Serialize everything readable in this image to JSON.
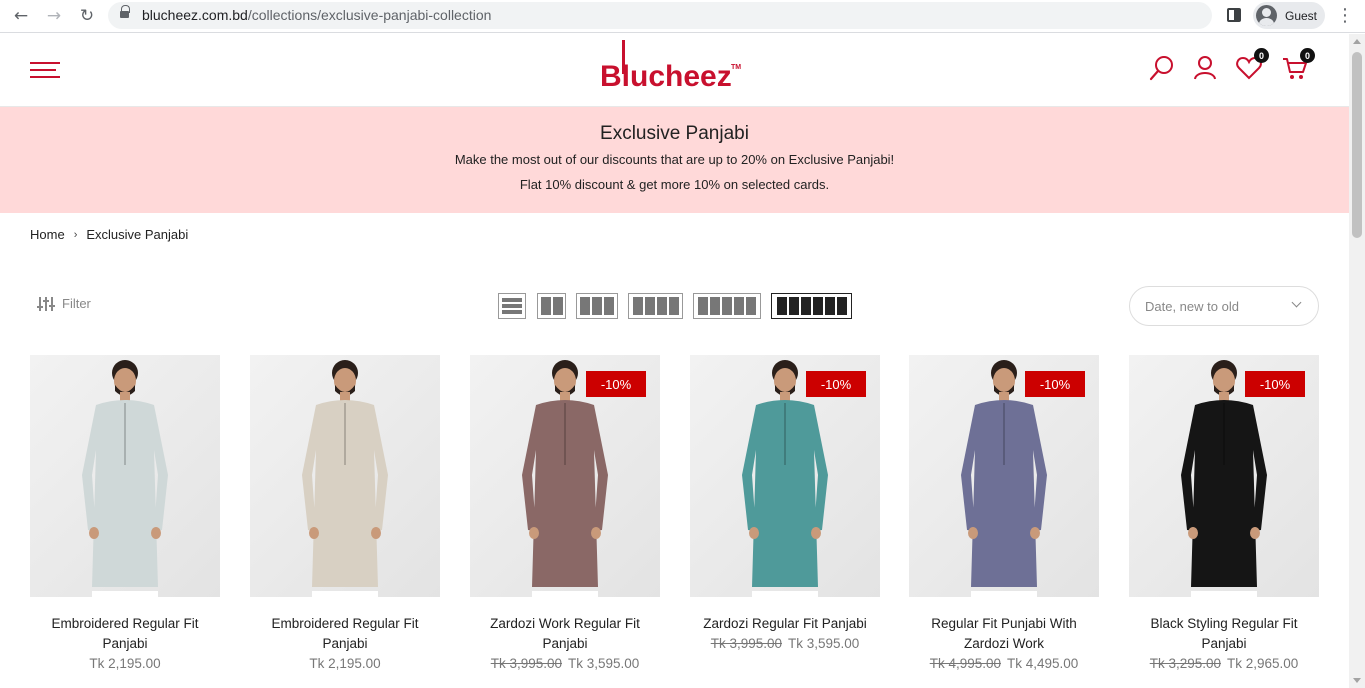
{
  "browser": {
    "url_host": "blucheez.com.bd",
    "url_path": "/collections/exclusive-panjabi-collection",
    "profile_label": "Guest"
  },
  "header": {
    "logo_text": "Blucheez",
    "logo_tm": "TM",
    "wishlist_count": "0",
    "cart_count": "0",
    "accent_color": "#c8102e"
  },
  "banner": {
    "title": "Exclusive Panjabi",
    "line1": "Make the most out of our discounts that are up to 20% on Exclusive Panjabi!",
    "line2": "Flat 10% discount & get more 10% on selected cards.",
    "background": "#ffd9d9"
  },
  "breadcrumb": {
    "home": "Home",
    "current": "Exclusive Panjabi"
  },
  "toolbar": {
    "filter_label": "Filter",
    "sort_value": "Date, new to old",
    "grid_options": [
      "list",
      "2-columns",
      "3-columns",
      "4-columns",
      "5-columns",
      "6-columns"
    ],
    "active_grid": "6-columns"
  },
  "products": [
    {
      "title": "Embroidered Regular Fit Panjabi",
      "price": "Tk 2,195.00",
      "compare_price": "",
      "badge": "",
      "color": "#cfd8d8"
    },
    {
      "title": "Embroidered Regular Fit Panjabi",
      "price": "Tk 2,195.00",
      "compare_price": "",
      "badge": "",
      "color": "#d8d0c3"
    },
    {
      "title": "Zardozi Work Regular Fit Panjabi",
      "price": "Tk 3,595.00",
      "compare_price": "Tk 3,995.00",
      "badge": "-10%",
      "color": "#8a6866"
    },
    {
      "title": "Zardozi Regular Fit Panjabi",
      "price": "Tk 3,595.00",
      "compare_price": "Tk 3,995.00",
      "badge": "-10%",
      "color": "#4f9a9a"
    },
    {
      "title": "Regular Fit Punjabi With Zardozi Work",
      "price": "Tk 4,495.00",
      "compare_price": "Tk 4,995.00",
      "badge": "-10%",
      "color": "#6e7096"
    },
    {
      "title": "Black Styling Regular Fit Panjabi",
      "price": "Tk 2,965.00",
      "compare_price": "Tk 3,295.00",
      "badge": "-10%",
      "color": "#151515"
    }
  ]
}
